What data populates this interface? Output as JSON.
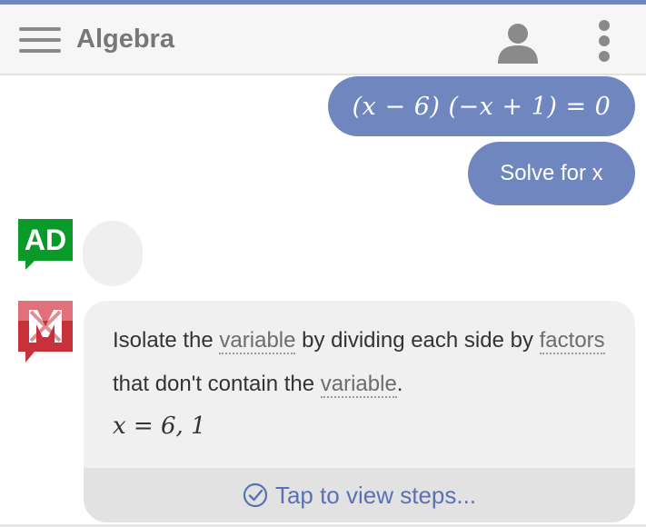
{
  "app": {
    "title": "Algebra"
  },
  "chat": {
    "user_equation": "(x − 6) (−x + 1) = 0",
    "user_command": "Solve for x",
    "ad_badge": "AD",
    "answer": {
      "part1": "Isolate the ",
      "term1": "variable",
      "part2": " by dividing each side by ",
      "term2": "factors",
      "part3": " that don't contain the ",
      "term3": "variable",
      "part4": ".",
      "result": "x = 6, 1",
      "steps_label": "Tap to view steps..."
    }
  },
  "colors": {
    "accent": "#6f86bf",
    "ad_green": "#0a9a2a",
    "logo_red": "#c8303a",
    "link_blue": "#5a72b5"
  },
  "icons": {
    "menu": "hamburger-menu-icon",
    "account": "account-icon",
    "more": "more-vert-icon",
    "check": "check-circle-icon",
    "logo": "mathway-logo"
  }
}
